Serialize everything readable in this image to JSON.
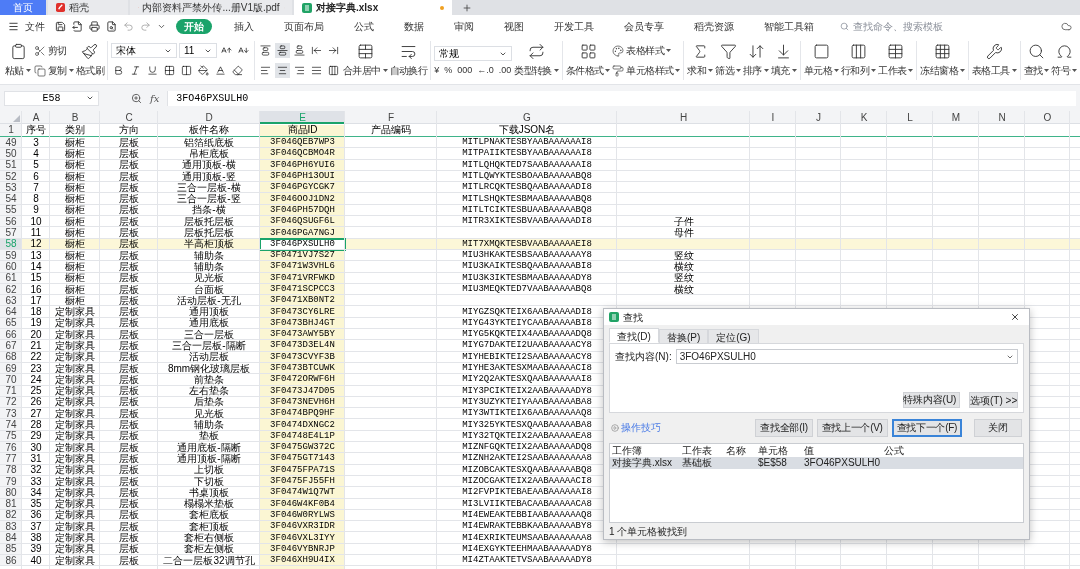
{
  "tabs": [
    {
      "kind": "home",
      "label": "首页",
      "selected": false,
      "unsaved": false
    },
    {
      "kind": "docer",
      "label": "稻壳",
      "selected": false,
      "unsaved": false
    },
    {
      "kind": "pdf",
      "label": "内部资料严禁外传...册V1版.pdf",
      "selected": false,
      "unsaved": false
    },
    {
      "kind": "sheet",
      "label": "对接字典.xlsx",
      "selected": true,
      "unsaved": true
    }
  ],
  "menu": {
    "file": "文件",
    "items": [
      {
        "label": "开始",
        "selected": true
      },
      {
        "label": "插入",
        "selected": false
      },
      {
        "label": "页面布局",
        "selected": false
      },
      {
        "label": "公式",
        "selected": false
      },
      {
        "label": "数据",
        "selected": false
      },
      {
        "label": "审阅",
        "selected": false
      },
      {
        "label": "视图",
        "selected": false
      },
      {
        "label": "开发工具",
        "selected": false
      },
      {
        "label": "会员专享",
        "selected": false
      },
      {
        "label": "稻壳资源",
        "selected": false
      },
      {
        "label": "智能工具箱",
        "selected": false
      }
    ],
    "search_placeholder": "查找命令、搜索模板"
  },
  "ribbon": {
    "paste": "粘贴",
    "cut": "剪切",
    "copy": "复制",
    "format_painter": "格式刷",
    "font": "宋体",
    "font_size": "11",
    "merge": "合并居中",
    "wrap": "自动换行",
    "number_format": "常规",
    "number_symbols": [
      "¥",
      "%",
      "000",
      "←.0",
      ".00"
    ],
    "convert": "类型转换",
    "conditional": "条件格式",
    "table_style": "表格样式",
    "cell_style": "单元格样式",
    "tools": [
      "求和",
      "筛选",
      "排序",
      "填充",
      "单元格",
      "行和列",
      "工作表",
      "冻结窗格",
      "表格工具",
      "查找",
      "符号"
    ]
  },
  "formula_bar": {
    "cell": "E58",
    "fx": "fx",
    "value": "3FO46PXSULH0"
  },
  "sheet": {
    "columns": [
      {
        "label": "A",
        "selected": false
      },
      {
        "label": "B",
        "selected": false
      },
      {
        "label": "C",
        "selected": false
      },
      {
        "label": "D",
        "selected": false
      },
      {
        "label": "E",
        "selected": true
      },
      {
        "label": "F",
        "selected": false
      },
      {
        "label": "G",
        "selected": false
      },
      {
        "label": "H",
        "selected": false
      },
      {
        "label": "I",
        "selected": false
      },
      {
        "label": "J",
        "selected": false
      },
      {
        "label": "K",
        "selected": false
      },
      {
        "label": "L",
        "selected": false
      },
      {
        "label": "M",
        "selected": false
      },
      {
        "label": "N",
        "selected": false
      },
      {
        "label": "O",
        "selected": false
      }
    ],
    "header_row": {
      "row": "1",
      "cells": [
        "序号",
        "类别",
        "方向",
        "板件名称",
        "商品ID",
        "产品编码",
        "下载JSON名"
      ]
    },
    "rows": [
      {
        "row": "49",
        "a": "3",
        "b": "橱柜",
        "c": "层板",
        "d": "铝箔纸底板",
        "e": "3F046QEB7WP3",
        "g": "MITLPNAKTESBYAABAAAAAAI8",
        "selected": false
      },
      {
        "row": "50",
        "a": "4",
        "b": "橱柜",
        "c": "层板",
        "d": "吊柜底板",
        "e": "3F046QCBMO4R",
        "g": "MITPAIIKTESBYAABAAAAAAI8",
        "selected": false
      },
      {
        "row": "51",
        "a": "5",
        "b": "橱柜",
        "c": "层板",
        "d": "通用顶板-横",
        "e": "3F046PH6YUI6",
        "g": "MITLQHQKTED7SAABAAAAAAI8",
        "selected": false
      },
      {
        "row": "52",
        "a": "6",
        "b": "橱柜",
        "c": "层板",
        "d": "通用顶板-竖",
        "e": "3F046PH13OUI",
        "g": "MITLQWYKTESBOAABAAAAABQ8",
        "selected": false
      },
      {
        "row": "53",
        "a": "7",
        "b": "橱柜",
        "c": "层板",
        "d": "三合一层板-横",
        "e": "3F046PGYCGK7",
        "g": "MITLRCQKTESBQAABAAAAADI8",
        "selected": false
      },
      {
        "row": "54",
        "a": "8",
        "b": "橱柜",
        "c": "层板",
        "d": "三合一层板-竖",
        "e": "3F046OOJ1DN2",
        "g": "MITLSHQKTESBMAABAAAAABQ8",
        "selected": false
      },
      {
        "row": "55",
        "a": "9",
        "b": "橱柜",
        "c": "层板",
        "d": "挡条-横",
        "e": "3F046PH57DQH",
        "g": "MITLTCIKTESBUAABAAAAABQ8",
        "selected": false
      },
      {
        "row": "56",
        "a": "10",
        "b": "橱柜",
        "c": "层板",
        "d": "层板托层板",
        "e": "3F046QSUGF6L",
        "g": "MITR3XIKTESBVAABAAAAADI8",
        "h": "子件",
        "selected": false
      },
      {
        "row": "57",
        "a": "11",
        "b": "橱柜",
        "c": "层板",
        "d": "层板托层板",
        "e": "3F046PGA7NGJ",
        "h": "母件",
        "selected": false
      },
      {
        "row": "58",
        "a": "12",
        "b": "橱柜",
        "c": "层板",
        "d": "半高柜顶板",
        "e": "3F046PXSULH0",
        "g": "MIT7XMQKTESBVAABAAAAAEI8",
        "selected": true
      },
      {
        "row": "59",
        "a": "13",
        "b": "橱柜",
        "c": "层板",
        "d": "辅助条",
        "e": "3F0471VJ7S27",
        "g": "MIU3HKAKTESBSAABAAAAAAY8",
        "h": "竖纹",
        "selected": false
      },
      {
        "row": "60",
        "a": "14",
        "b": "橱柜",
        "c": "层板",
        "d": "辅助条",
        "e": "3F0471W3VHL6",
        "g": "MIU3KAIKTESBQAABAAAAABI8",
        "h": "横纹",
        "selected": false
      },
      {
        "row": "61",
        "a": "15",
        "b": "橱柜",
        "c": "层板",
        "d": "见光板",
        "e": "3F0471VRFWKD",
        "g": "MIU3K3IKTESBMAABAAAAADY8",
        "h": "竖纹",
        "selected": false
      },
      {
        "row": "62",
        "a": "16",
        "b": "橱柜",
        "c": "层板",
        "d": "台面板",
        "e": "3F0471SCPCC3",
        "g": "MIU3MEQKTED7VAABAAAAABQ8",
        "h": "横纹",
        "selected": false
      },
      {
        "row": "63",
        "a": "17",
        "b": "橱柜",
        "c": "层板",
        "d": "活动层板-无孔",
        "e": "3F0471XB0NT2",
        "selected": false
      },
      {
        "row": "64",
        "a": "18",
        "b": "定制家具",
        "c": "层板",
        "d": "通用顶板",
        "e": "3F0473CY6LRE",
        "g": "MIYGZSQKTEIX6AABAAAAADI8",
        "selected": false
      },
      {
        "row": "65",
        "a": "19",
        "b": "定制家具",
        "c": "层板",
        "d": "通用底板",
        "e": "3F0473BHJ4GT",
        "g": "MIYG43YKTEIYCAABAAAAABI8",
        "selected": false
      },
      {
        "row": "66",
        "a": "20",
        "b": "定制家具",
        "c": "层板",
        "d": "三合一层板",
        "e": "3F0473AWY5BY",
        "g": "MIYG5KQKTEIX4AABAAAAADQ8",
        "selected": false
      },
      {
        "row": "67",
        "a": "21",
        "b": "定制家具",
        "c": "层板",
        "d": "三合一层板-隔断",
        "e": "3F0473D3EL4N",
        "g": "MIYG7DAKTEI2UAABAAAAACY8",
        "selected": false
      },
      {
        "row": "68",
        "a": "22",
        "b": "定制家具",
        "c": "层板",
        "d": "活动层板",
        "e": "3F0473CVYF3B",
        "g": "MIYHEBIKTEI2SAABAAAAACY8",
        "selected": false
      },
      {
        "row": "69",
        "a": "23",
        "b": "定制家具",
        "c": "层板",
        "d": "8mm钢化玻璃层板",
        "e": "3F0473BTCUWK",
        "g": "MIYHE3AKTESXMAABAAAAACI8",
        "selected": false
      },
      {
        "row": "70",
        "a": "24",
        "b": "定制家具",
        "c": "层板",
        "d": "前垫条",
        "e": "3F0472ORWF6H",
        "g": "MIY2Q2AKTESXQAABAAAAAAI8",
        "selected": false
      },
      {
        "row": "71",
        "a": "25",
        "b": "定制家具",
        "c": "层板",
        "d": "左右垫条",
        "e": "3F0473J47D05",
        "g": "MIY3PCIKTEIX2AABAAAAADY8",
        "selected": false
      },
      {
        "row": "72",
        "a": "26",
        "b": "定制家具",
        "c": "层板",
        "d": "后垫条",
        "e": "3F0473NEVH6H",
        "g": "MIY3UZYKTEIYAAABAAAAABA8",
        "selected": false
      },
      {
        "row": "73",
        "a": "27",
        "b": "定制家具",
        "c": "层板",
        "d": "见光板",
        "e": "3F0474BPQ9HF",
        "g": "MIY3WTIKTEIX6AABAAAAAAQ8",
        "selected": false
      },
      {
        "row": "74",
        "a": "28",
        "b": "定制家具",
        "c": "层板",
        "d": "辅助条",
        "e": "3F0474DXNGC2",
        "g": "MIY325YKTESXQAABAAAAABA8",
        "selected": false
      },
      {
        "row": "75",
        "a": "29",
        "b": "定制家具",
        "c": "层板",
        "d": "垫板",
        "e": "3F04748E4L1P",
        "g": "MIY32TQKTEIX2AABAAAAAEA8",
        "selected": false
      },
      {
        "row": "76",
        "a": "30",
        "b": "定制家具",
        "c": "层板",
        "d": "通用底板-隔断",
        "e": "3F0475GW372C",
        "g": "MIZNFGQKTEIX2AABAAAAADQ8",
        "selected": false
      },
      {
        "row": "77",
        "a": "31",
        "b": "定制家具",
        "c": "层板",
        "d": "通用顶板-隔断",
        "e": "3F0475GT7143",
        "g": "MIZNH2AKTEI2SAABAAAAAAA8",
        "selected": false
      },
      {
        "row": "78",
        "a": "32",
        "b": "定制家具",
        "c": "层板",
        "d": "上切板",
        "e": "3F0475FPA71S",
        "g": "MIZOBCAKTESXQAABAAAAABQ8",
        "selected": false
      },
      {
        "row": "79",
        "a": "33",
        "b": "定制家具",
        "c": "层板",
        "d": "下切板",
        "e": "3F0475FJ55FH",
        "g": "MIZOCGAKTEIX2AABAAAAACI8",
        "selected": false
      },
      {
        "row": "80",
        "a": "34",
        "b": "定制家具",
        "c": "层板",
        "d": "书桌顶板",
        "e": "3F0474W1Q7WT",
        "g": "MI2FVPIKTEBAEAABAAAAAAI8",
        "selected": false
      },
      {
        "row": "81",
        "a": "35",
        "b": "定制家具",
        "c": "层板",
        "d": "榻榻米垫板",
        "e": "3F046W4KF0B4",
        "g": "MI3LVIIKTEBACAABAAAAACA8",
        "selected": false
      },
      {
        "row": "82",
        "a": "36",
        "b": "定制家具",
        "c": "层板",
        "d": "套柜底板",
        "e": "3F046W0RYLWS",
        "g": "MI4EWEAKTEBBIAABAAAAAAQ8",
        "selected": false
      },
      {
        "row": "83",
        "a": "37",
        "b": "定制家具",
        "c": "层板",
        "d": "套柜顶板",
        "e": "3F046VXR3IDR",
        "g": "MI4EWRAKTEBBKAABAAAAABY8",
        "selected": false
      },
      {
        "row": "84",
        "a": "38",
        "b": "定制家具",
        "c": "层板",
        "d": "套柜右侧板",
        "e": "3F046VXL3IYY",
        "g": "MI4EXRIKTEUMSAABAAAAAAA8",
        "selected": false
      },
      {
        "row": "85",
        "a": "39",
        "b": "定制家具",
        "c": "层板",
        "d": "套柜左侧板",
        "e": "3F046VYBNRJP",
        "g": "MI4EXGYKTEEHMAABAAAAADY8",
        "selected": false
      },
      {
        "row": "86",
        "a": "40",
        "b": "定制家具",
        "c": "层板",
        "d": "二合一层板32调节孔",
        "e": "3F046XH9U4IX",
        "g": "MI4ZTAAKTETVSAABAAAAADY8",
        "selected": false
      }
    ]
  },
  "find_dialog": {
    "title": "查找",
    "tabs": [
      {
        "label": "查找(D)",
        "selected": true
      },
      {
        "label": "替换(P)",
        "selected": false
      },
      {
        "label": "定位(G)",
        "selected": false
      }
    ],
    "find_label": "查找内容(N):",
    "find_value": "3FO46PXSULH0",
    "special_button": "特殊内容(U)",
    "options_button": "选项(T) >>",
    "tips_link": "操作技巧",
    "buttons": [
      {
        "label": "查找全部(I)",
        "focused": false
      },
      {
        "label": "查找上一个(V)",
        "focused": false
      },
      {
        "label": "查找下一个(F)",
        "focused": true
      },
      {
        "label": "关闭",
        "focused": false
      }
    ],
    "results": {
      "columns": [
        "工作簿",
        "工作表",
        "名称",
        "单元格",
        "值",
        "公式"
      ],
      "rows": [
        {
          "workbook": "对接字典.xlsx",
          "sheet": "基础板",
          "cell": "$E$58",
          "value": "3FO46PXSULH0",
          "selected": true
        }
      ]
    },
    "status": "1 个单元格被找到"
  }
}
